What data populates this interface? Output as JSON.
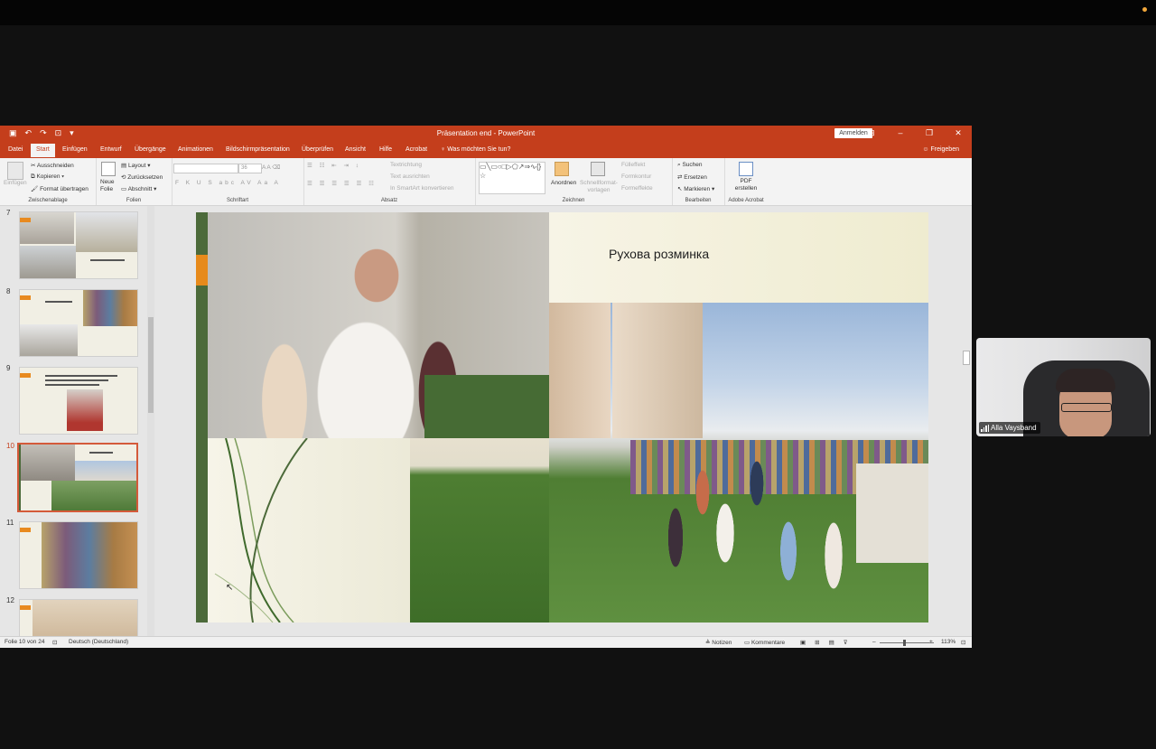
{
  "window": {
    "title": "Präsentation end  -  PowerPoint",
    "signin_label": "Anmelden",
    "share_label": "Freigeben"
  },
  "menu": {
    "tabs": [
      "Datei",
      "Start",
      "Einfügen",
      "Entwurf",
      "Übergänge",
      "Animationen",
      "Bildschirmpräsentation",
      "Überprüfen",
      "Ansicht",
      "Hilfe",
      "Acrobat"
    ],
    "active_tab": "Start",
    "tell_me": "Was möchten Sie tun?"
  },
  "ribbon": {
    "clipboard": {
      "group_label": "Zwischenablage",
      "paste": "Einfügen",
      "cut": "Ausschneiden",
      "copy": "Kopieren",
      "format_painter": "Format übertragen"
    },
    "slides": {
      "group_label": "Folien",
      "new_slide": "Neue Folie",
      "layout": "Layout",
      "reset": "Zurücksetzen",
      "section": "Abschnitt"
    },
    "font": {
      "group_label": "Schriftart",
      "size": "36"
    },
    "paragraph": {
      "group_label": "Absatz",
      "text_direction": "Textrichtung",
      "align_text": "Text ausrichten",
      "smartart": "In SmartArt konvertieren"
    },
    "drawing": {
      "group_label": "Zeichnen",
      "arrange": "Anordnen",
      "quick_styles": "Schnellformat-vorlagen",
      "fill": "Fülleffekt",
      "outline": "Formkontur",
      "effects": "Formeffekte"
    },
    "editing": {
      "group_label": "Bearbeiten",
      "find": "Suchen",
      "replace": "Ersetzen",
      "select": "Markieren"
    },
    "acrobat": {
      "group_label": "Adobe Acrobat",
      "pdf": "PDF erstellen"
    }
  },
  "thumbnails": [
    {
      "number": "7"
    },
    {
      "number": "8"
    },
    {
      "number": "9"
    },
    {
      "number": "10",
      "selected": true
    },
    {
      "number": "11"
    },
    {
      "number": "12"
    }
  ],
  "slide": {
    "title": "Рухова розминка"
  },
  "status": {
    "slide_of": "Folie 10 von 24",
    "language": "Deutsch (Deutschland)",
    "notes": "Notizen",
    "comments": "Kommentare",
    "zoom": "113%"
  },
  "video": {
    "participant_name": "Alla Vaysband"
  },
  "colors": {
    "ppt_accent": "#c43e1c",
    "slide_bar": "#4c6a3a",
    "slide_marker": "#e78a1b"
  }
}
